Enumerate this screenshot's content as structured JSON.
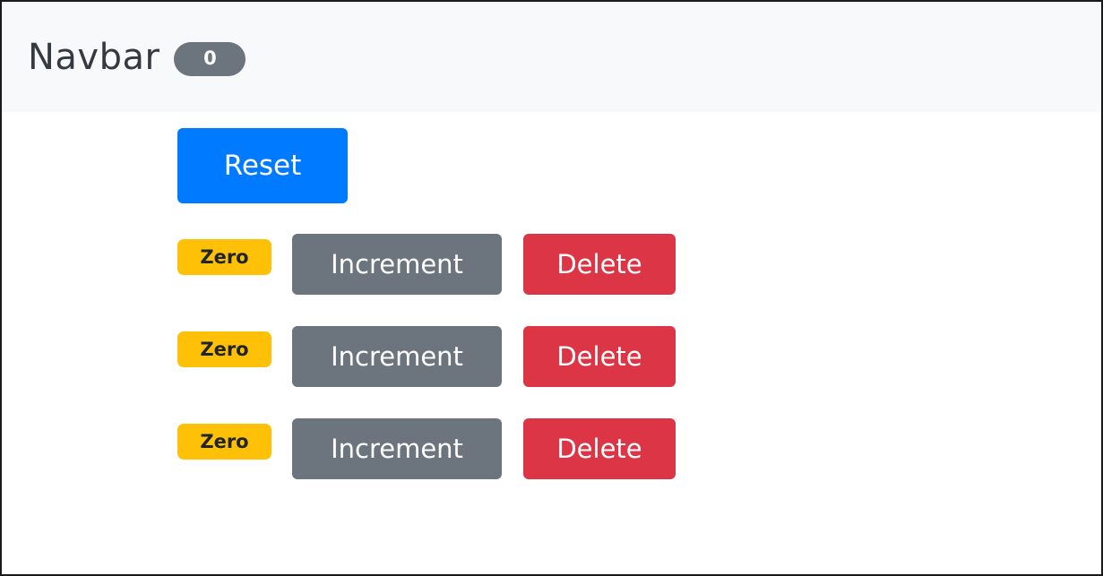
{
  "navbar": {
    "brand": "Navbar",
    "total_count": "0"
  },
  "controls": {
    "reset_label": "Reset"
  },
  "counters": [
    {
      "badge_text": "Zero",
      "increment_label": "Increment",
      "delete_label": "Delete"
    },
    {
      "badge_text": "Zero",
      "increment_label": "Increment",
      "delete_label": "Delete"
    },
    {
      "badge_text": "Zero",
      "increment_label": "Increment",
      "delete_label": "Delete"
    }
  ],
  "colors": {
    "navbar_bg": "#f8f9fa",
    "pill_bg": "#6c757d",
    "primary": "#007bff",
    "warning": "#ffc107",
    "secondary": "#6c757d",
    "danger": "#dc3545"
  }
}
